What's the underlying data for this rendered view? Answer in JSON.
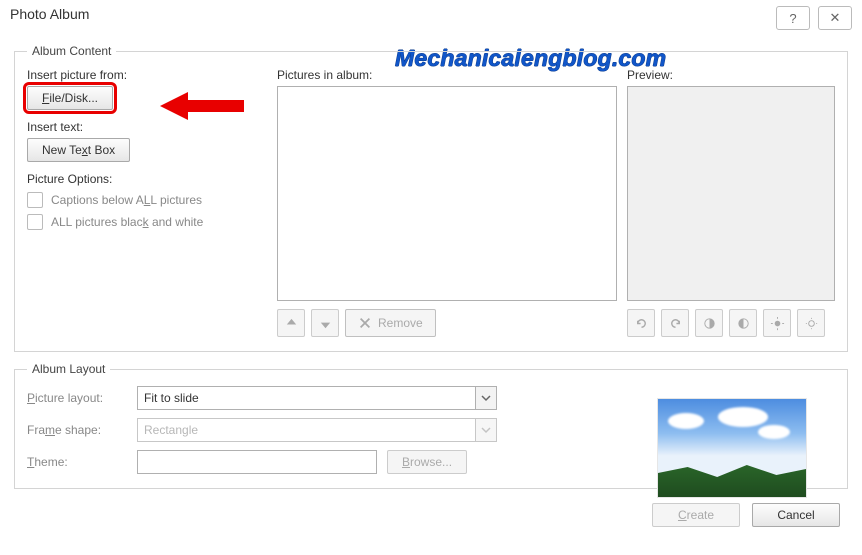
{
  "dialog": {
    "title": "Photo Album",
    "help": "?",
    "close": "✕"
  },
  "overlay": {
    "watermark": "Mechanicalengblog.com"
  },
  "albumContent": {
    "legend": "Album Content",
    "insertPictureFromLabel": "Insert picture from:",
    "fileDiskButton": "File/Disk...",
    "insertTextLabel": "Insert text:",
    "newTextBoxButton": "New Text Box",
    "pictureOptionsLabel": "Picture Options:",
    "captionsBelow": "Captions below ALL pictures",
    "allBlackWhite": "ALL pictures black and white",
    "picturesInAlbumLabel": "Pictures in album:",
    "previewLabel": "Preview:",
    "removeButton": "Remove"
  },
  "albumLayout": {
    "legend": "Album Layout",
    "pictureLayoutLabel": "Picture layout:",
    "pictureLayoutValue": "Fit to slide",
    "frameShapeLabel": "Frame shape:",
    "frameShapeValue": "Rectangle",
    "themeLabel": "Theme:",
    "themeValue": "",
    "browseButton": "Browse..."
  },
  "footer": {
    "create": "Create",
    "cancel": "Cancel"
  }
}
